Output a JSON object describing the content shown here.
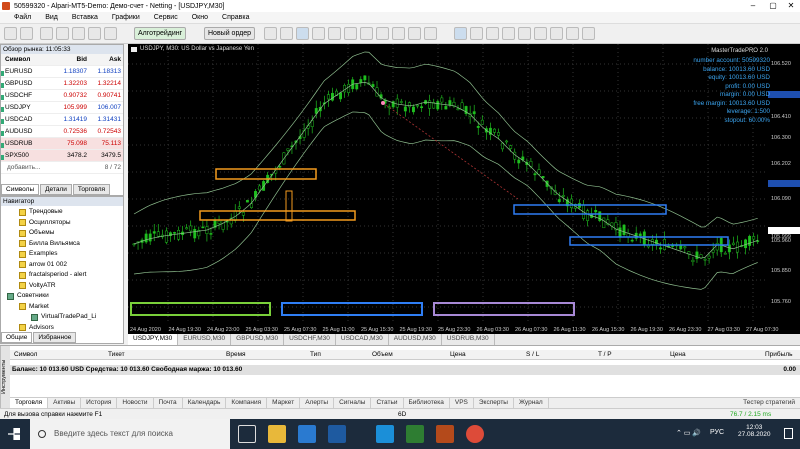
{
  "window": {
    "title": "50599320 - Alpari-MT5-Demo: Демо-счет - Netting - [USDJPY,M30]"
  },
  "menu": [
    "Файл",
    "Вид",
    "Вставка",
    "Графики",
    "Сервис",
    "Окно",
    "Справка"
  ],
  "toolbar": {
    "algo": "Алготрейдинг",
    "new_order": "Новый ордер"
  },
  "market_watch": {
    "title": "Обзор рынка: 11:05:33",
    "col_symbol": "Символ",
    "col_bid": "Bid",
    "col_ask": "Ask",
    "rows": [
      {
        "s": "EURUSD",
        "b": "1.18307",
        "a": "1.18313"
      },
      {
        "s": "GBPUSD",
        "b": "1.32203",
        "a": "1.32214"
      },
      {
        "s": "USDCHF",
        "b": "0.90732",
        "a": "0.90741"
      },
      {
        "s": "USDJPY",
        "b": "105.999",
        "a": "106.007"
      },
      {
        "s": "USDCAD",
        "b": "1.31419",
        "a": "1.31431"
      },
      {
        "s": "AUDUSD",
        "b": "0.72536",
        "a": "0.72543"
      },
      {
        "s": "USDRUB",
        "b": "75.098",
        "a": "75.113"
      },
      {
        "s": "SPX500",
        "b": "3478.2",
        "a": "3479.5"
      }
    ],
    "add": "добавить...",
    "count": "8 / 72",
    "tabs": [
      "Символы",
      "Детали",
      "Торговля"
    ]
  },
  "navigator": {
    "title": "Навигатор",
    "items": [
      "Трендовые",
      "Осцилляторы",
      "Объемы",
      "Билла Вильямса",
      "Examples",
      "arrow 01 002",
      "fractalsperiod - alert",
      "VoltyATR",
      "Советники",
      "Market",
      "VirtualTradePad_Li",
      "Advisors"
    ],
    "tabs": [
      "Общие",
      "Избранное"
    ]
  },
  "chart": {
    "header": "USDJPY, M30:  US Dollar vs Japanese Yen",
    "expert": "MasterTradePRO 2.0",
    "info": [
      "number account: 50599320",
      "balance: 10013.60 USD",
      "equity: 10013.60 USD",
      "profit: 0.00 USD",
      "margin: 0.00 USD",
      "free margin: 10013.60 USD",
      "leverage: 1:500",
      "stopout: 60.00%"
    ],
    "price_labels": [
      "106.520",
      "106.484",
      "106.410",
      "106.300",
      "106.202",
      "106.090",
      "105.999",
      "105.960",
      "105.850",
      "105.760"
    ],
    "time_labels": [
      "24 Aug 2020",
      "24 Aug 19:30",
      "24 Aug 23:00",
      "25 Aug 03:30",
      "25 Aug 07:30",
      "25 Aug 11:00",
      "25 Aug 15:30",
      "25 Aug 19:30",
      "25 Aug 23:30",
      "26 Aug 03:30",
      "26 Aug 07:30",
      "26 Aug 11:30",
      "26 Aug 15:30",
      "26 Aug 19:30",
      "26 Aug 23:30",
      "27 Aug 03:30",
      "27 Aug 07:30"
    ]
  },
  "chart_tabs": [
    "USDJPY,M30",
    "EURUSD,M30",
    "GBPUSD,M30",
    "USDCHF,M30",
    "USDCAD,M30",
    "AUDUSD,M30",
    "USDRUB,M30"
  ],
  "terminal": {
    "cols": [
      "Символ",
      "Тикет",
      "Время",
      "Тип",
      "Объем",
      "Цена",
      "S / L",
      "T / P",
      "Цена",
      "Прибыль"
    ],
    "balance": "Баланс: 10 013.60 USD  Средства: 10 013.60  Свободная маржа: 10 013.60",
    "profit": "0.00",
    "tabs": [
      "Торговля",
      "Активы",
      "История",
      "Новости",
      "Почта",
      "Календарь",
      "Компания",
      "Маркет",
      "Алерты",
      "Сигналы",
      "Статьи",
      "Библиотека",
      "VPS",
      "Эксперты",
      "Журнал"
    ],
    "tester": "Тестер стратегий",
    "side": "Инструменты"
  },
  "status": {
    "help": "Для вызова справки нажмите F1",
    "mid": "6D",
    "ping": "76.7 / 2.15 ms"
  },
  "taskbar": {
    "search": "Введите здесь текст для поиска",
    "lang": "РУС",
    "time": "12:03",
    "date": "27.08.2020"
  },
  "colors": {
    "buy": "#16a016",
    "chart_bg": "#000000",
    "box_orange": "#f39a1e",
    "box_blue": "#2f7ef5"
  }
}
